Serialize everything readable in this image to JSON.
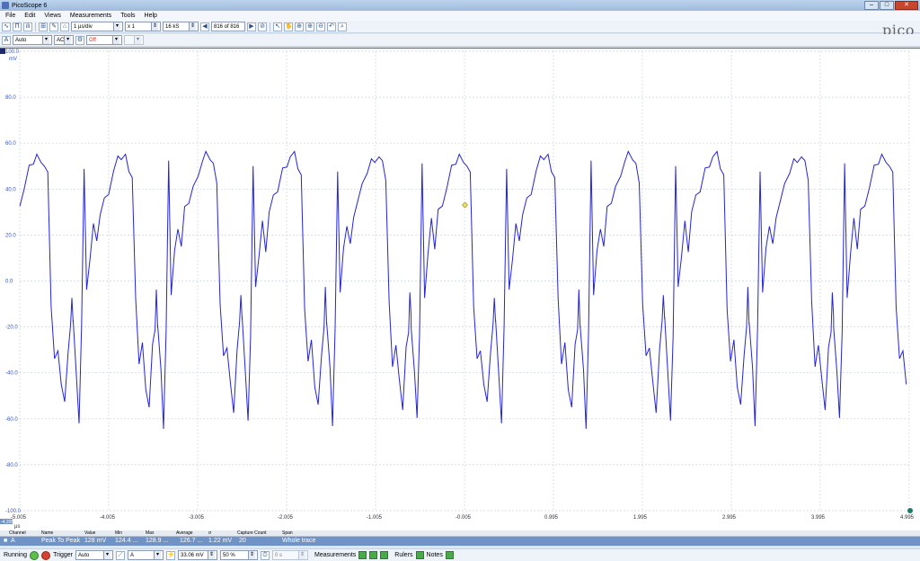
{
  "window": {
    "title": "PicoScope 6",
    "buttons": [
      "–",
      "□",
      "✕"
    ]
  },
  "menu": [
    "File",
    "Edit",
    "Views",
    "Measurements",
    "Tools",
    "Help"
  ],
  "toolbar": {
    "timebase": "1 µs/div",
    "zoom": "x 1",
    "samples": "16 kS",
    "buffer": "816 of 816"
  },
  "channel": {
    "name": "A",
    "range": "Auto",
    "coupling": "AC",
    "filter": "Off"
  },
  "logo": {
    "name": "pico",
    "sub": "Technology"
  },
  "plot": {
    "y_unit": "mV",
    "x_unit": "µs",
    "y_ticks": [
      "100.0",
      "80.0",
      "60.0",
      "40.0",
      "20.0",
      "0.0",
      "-20.0",
      "-40.0",
      "-60.0",
      "-80.0",
      "-100.0"
    ],
    "x_ticks": [
      "-5.005",
      "-4.005",
      "-3.005",
      "-2.005",
      "-1.005",
      "-0.005",
      "0.995",
      "1.995",
      "2.995",
      "3.995",
      "4.995"
    ],
    "trace_color": "#2424d6",
    "ruler_value": "-4.205"
  },
  "chart_data": {
    "type": "line",
    "xlabel": "µs",
    "ylabel": "mV",
    "xlim": [
      -5.005,
      4.995
    ],
    "ylim": [
      -100,
      100
    ],
    "grid": true,
    "series": [
      {
        "name": "A",
        "period_us": 0.95,
        "cycle_shape_x_fraction": [
          0.0,
          0.04,
          0.07,
          0.1,
          0.13,
          0.16,
          0.2,
          0.24,
          0.28,
          0.32,
          0.37,
          0.42,
          0.48,
          0.53,
          0.57,
          0.62,
          0.66,
          0.7,
          0.74,
          0.78,
          0.82,
          0.86,
          0.9,
          0.94,
          0.97,
          0.985,
          1.0
        ],
        "cycle_shape_y_mV": [
          -18,
          -40,
          -62,
          -22,
          50,
          -5,
          12,
          25,
          15,
          30,
          35,
          40,
          48,
          52,
          54,
          54,
          50,
          45,
          -10,
          -35,
          -28,
          -45,
          -55,
          -30,
          -20,
          -5,
          -18
        ]
      }
    ]
  },
  "measurements": {
    "headers": [
      "Channel",
      "Name",
      "Value",
      "Min",
      "Max",
      "Average",
      "σ",
      "Capture Count",
      "Span"
    ],
    "rows": [
      {
        "channel": "A",
        "name": "Peak To Peak",
        "value": "128 mV",
        "min": "124.4 ...",
        "max": "128.9 ...",
        "average": "126.7 ...",
        "sigma": "1.22 mV",
        "count": "20",
        "span": "Whole trace"
      }
    ]
  },
  "status": {
    "state": "Running",
    "trigger_label": "Trigger",
    "trigger_mode": "Auto",
    "trigger_channel": "A",
    "trigger_level": "33.06 mV",
    "pretrigger": "50 %",
    "delay": "0 s",
    "measurements_label": "Measurements",
    "rulers_label": "Rulers",
    "notes_label": "Notes"
  }
}
